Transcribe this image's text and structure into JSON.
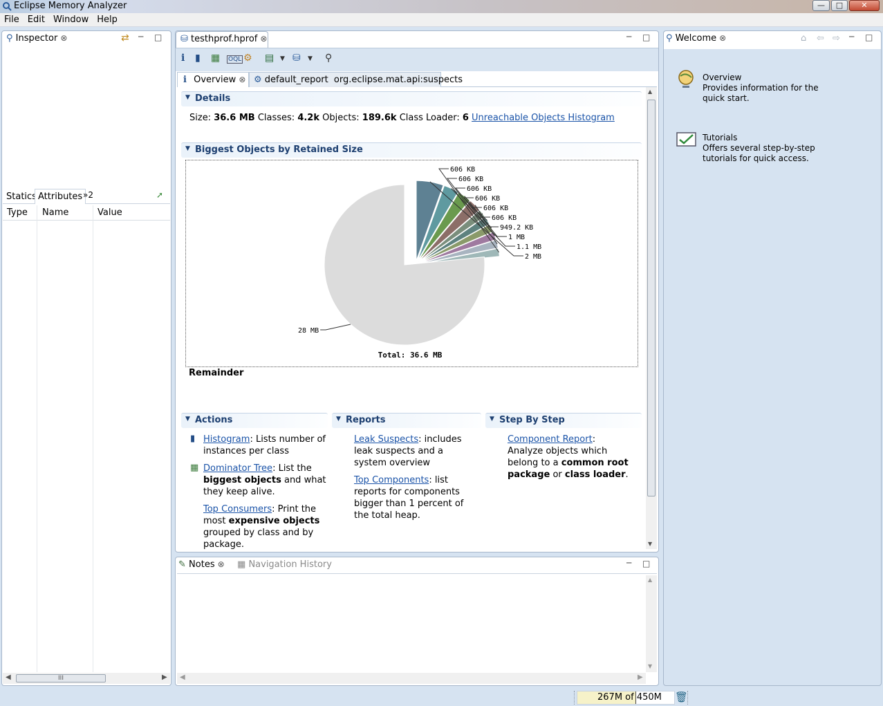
{
  "app": {
    "title": "Eclipse Memory Analyzer"
  },
  "window_buttons": [
    "—",
    "□",
    "✕"
  ],
  "menu": [
    "File",
    "Edit",
    "Window",
    "Help"
  ],
  "inspector": {
    "tab": "Inspector",
    "subtabs": [
      "Statics",
      "Attributes",
      "»2"
    ],
    "columns": [
      "Type",
      "Name",
      "Value"
    ],
    "hscroll_grip": "III"
  },
  "editor": {
    "tab": "testhprof.hprof",
    "toolbar": [
      "info-icon",
      "histogram-icon",
      "dominator-tree-icon",
      "oql-icon",
      "thread-overview-icon",
      "run-report-icon",
      "query-browser-icon",
      "search-icon"
    ],
    "subtabs": {
      "overview": "Overview",
      "report_name": "default_report",
      "report_id": "org.eclipse.mat.api:suspects"
    },
    "details": {
      "heading": "Details",
      "size_label": "Size:",
      "size": "36.6 MB",
      "classes_label": "Classes:",
      "classes": "4.2k",
      "objects_label": "Objects:",
      "objects": "189.6k",
      "loader_label": "Class Loader:",
      "loader": "6",
      "histogram_link": "Unreachable Objects Histogram"
    },
    "biggest": {
      "heading": "Biggest Objects by Retained Size",
      "selection_label": "Remainder"
    },
    "actions": {
      "heading": "Actions",
      "items": [
        {
          "link": "Histogram",
          "text": ": Lists number of instances per class"
        },
        {
          "link": "Dominator Tree",
          "t1": ": List the ",
          "b1": "biggest objects",
          "t2": " and what they keep alive."
        },
        {
          "link": "Top Consumers",
          "t1": ": Print the most ",
          "b1": "expensive objects",
          "t2": " grouped by class and by package."
        }
      ]
    },
    "reports": {
      "heading": "Reports",
      "items": [
        {
          "link": "Leak Suspects",
          "text": ": includes leak suspects and a system overview"
        },
        {
          "link": "Top Components",
          "text": ": list reports for components bigger than 1 percent of the total heap."
        }
      ]
    },
    "stepbystep": {
      "heading": "Step By Step",
      "link": "Component Report",
      "t1": ": Analyze objects which belong to a ",
      "b1": "common root package",
      "t2": " or ",
      "b2": "class loader",
      "t3": "."
    }
  },
  "chart_data": {
    "type": "pie",
    "unit": "MB",
    "total_label": "Total: 36.6 MB",
    "slices": [
      {
        "label": "2 MB",
        "value": 2.0,
        "color": "#5e8193"
      },
      {
        "label": "1.1 MB",
        "value": 1.1,
        "color": "#5f9aa0"
      },
      {
        "label": "1 MB",
        "value": 1.0,
        "color": "#6a9a4e"
      },
      {
        "label": "949.2 KB",
        "value": 0.93,
        "color": "#8c6e68"
      },
      {
        "label": "606 KB",
        "value": 0.59,
        "color": "#7a8e7c"
      },
      {
        "label": "606 KB",
        "value": 0.59,
        "color": "#5e827f"
      },
      {
        "label": "606 KB",
        "value": 0.59,
        "color": "#8a9a6a"
      },
      {
        "label": "606 KB",
        "value": 0.59,
        "color": "#9f7aa0"
      },
      {
        "label": "606 KB",
        "value": 0.59,
        "color": "#a8b4c0"
      },
      {
        "label": "606 KB",
        "value": 0.59,
        "color": "#9fb8b8"
      },
      {
        "label": "28 MB",
        "value": 28.0,
        "color": "#dcdcdc"
      }
    ]
  },
  "notes": {
    "tab": "Notes",
    "other_tab": "Navigation History"
  },
  "welcome": {
    "tab": "Welcome",
    "items": [
      {
        "title": "Overview",
        "desc": "Provides information for the quick start.",
        "icon": "globe-icon"
      },
      {
        "title": "Tutorials",
        "desc": "Offers several step-by-step tutorials for quick access.",
        "icon": "tutorial-icon"
      }
    ]
  },
  "status": {
    "heap": "267M of 450M"
  }
}
